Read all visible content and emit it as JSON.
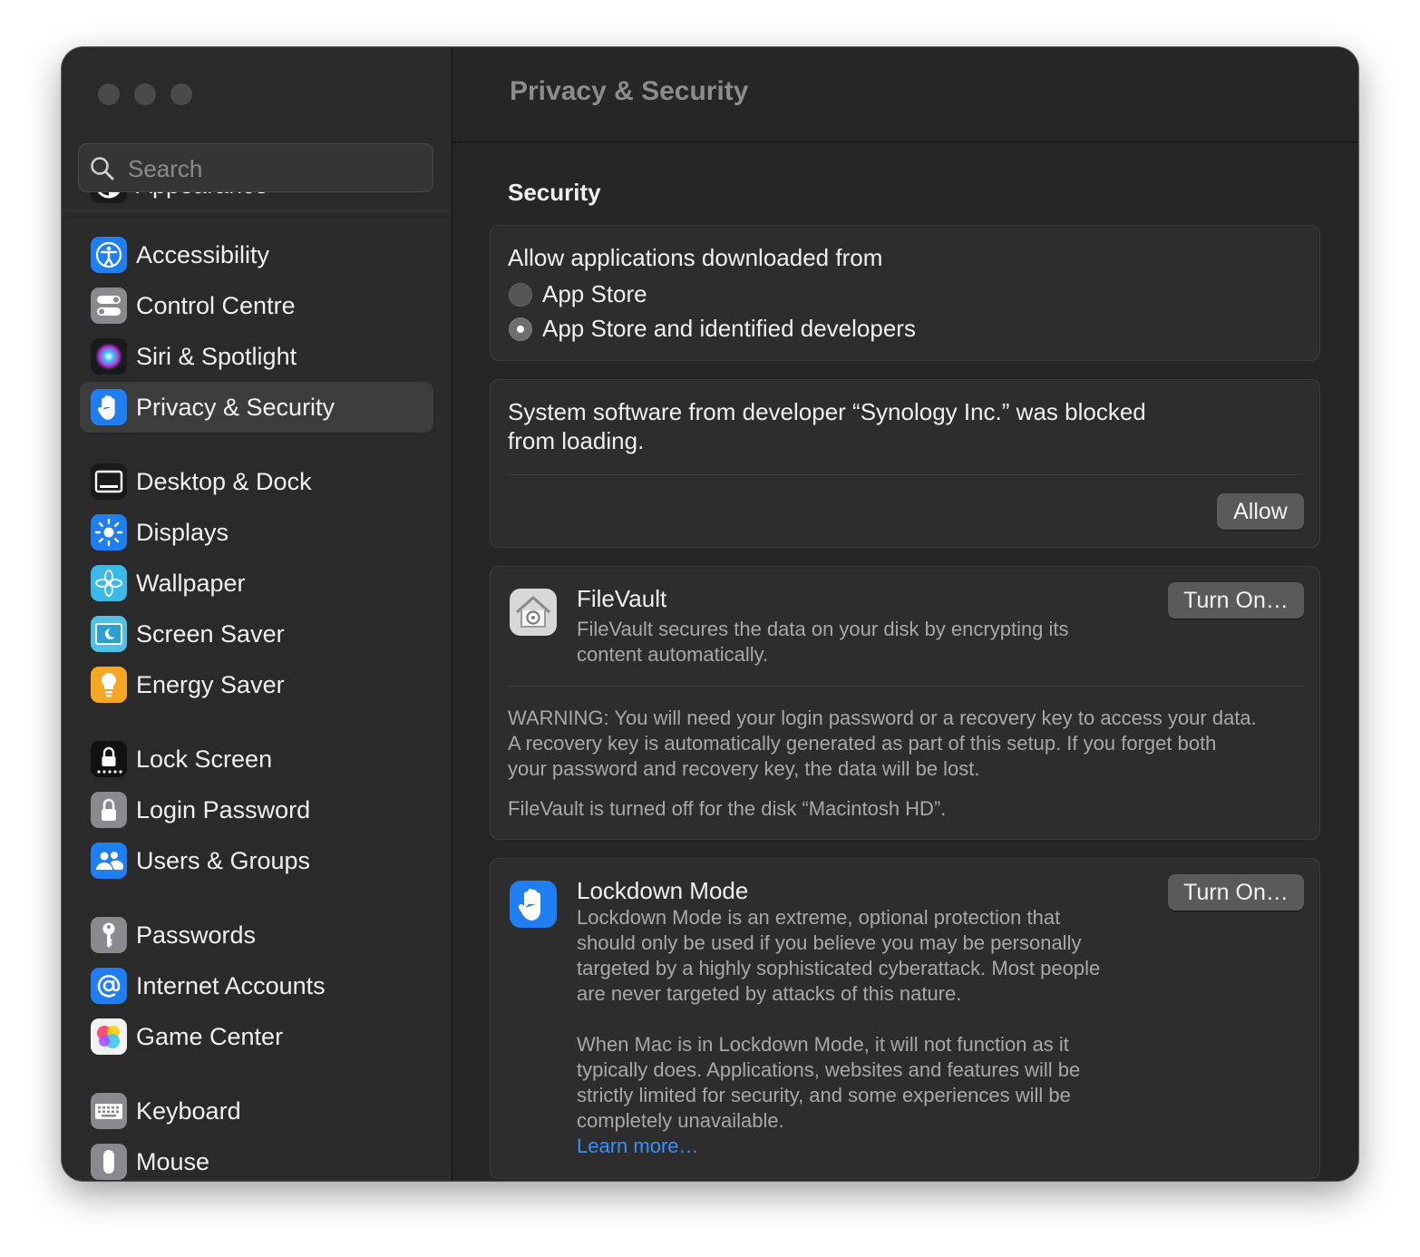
{
  "window": {
    "title": "Privacy & Security"
  },
  "sidebar": {
    "search_placeholder": "Search",
    "partial_item": "Appearance",
    "items": [
      {
        "label": "Accessibility",
        "icon": "accessibility-icon"
      },
      {
        "label": "Control Centre",
        "icon": "control-centre-icon"
      },
      {
        "label": "Siri & Spotlight",
        "icon": "siri-icon"
      },
      {
        "label": "Privacy & Security",
        "icon": "privacy-hand-icon",
        "selected": true
      },
      {
        "label": "Desktop & Dock",
        "icon": "desktop-dock-icon"
      },
      {
        "label": "Displays",
        "icon": "displays-icon"
      },
      {
        "label": "Wallpaper",
        "icon": "wallpaper-icon"
      },
      {
        "label": "Screen Saver",
        "icon": "screen-saver-icon"
      },
      {
        "label": "Energy Saver",
        "icon": "energy-saver-icon"
      },
      {
        "label": "Lock Screen",
        "icon": "lock-screen-icon"
      },
      {
        "label": "Login Password",
        "icon": "login-password-icon"
      },
      {
        "label": "Users & Groups",
        "icon": "users-groups-icon"
      },
      {
        "label": "Passwords",
        "icon": "passwords-key-icon"
      },
      {
        "label": "Internet Accounts",
        "icon": "internet-accounts-icon"
      },
      {
        "label": "Game Center",
        "icon": "game-center-icon"
      },
      {
        "label": "Keyboard",
        "icon": "keyboard-icon"
      },
      {
        "label": "Mouse",
        "icon": "mouse-icon"
      }
    ]
  },
  "main": {
    "section_title": "Security",
    "allow_apps": {
      "heading": "Allow applications downloaded from",
      "options": [
        {
          "label": "App Store",
          "selected": false
        },
        {
          "label": "App Store and identified developers",
          "selected": true
        }
      ]
    },
    "blocked": {
      "line1": "System software from developer “Synology Inc.” was blocked",
      "line2": "from loading.",
      "button": "Allow"
    },
    "filevault": {
      "title": "FileVault",
      "desc1": "FileVault secures the data on your disk by encrypting its",
      "desc2": "content automatically.",
      "button": "Turn On…",
      "warning1": "WARNING: You will need your login password or a recovery key to access your data.",
      "warning2": "A recovery key is automatically generated as part of this setup. If you forget both",
      "warning3": "your password and recovery key, the data will be lost.",
      "status": "FileVault is turned off for the disk “Macintosh HD”."
    },
    "lockdown": {
      "title": "Lockdown Mode",
      "button": "Turn On…",
      "para1": [
        "Lockdown Mode is an extreme, optional protection that",
        "should only be used if you believe you may be personally",
        "targeted by a highly sophisticated cyberattack. Most people",
        "are never targeted by attacks of this nature."
      ],
      "para2": [
        "When Mac is in Lockdown Mode, it will not function as it",
        "typically does. Applications, websites and features will be",
        "strictly limited for security, and some experiences will be",
        "completely unavailable."
      ],
      "link": "Learn more…"
    }
  },
  "colors": {
    "accent_link": "#3d8ff6",
    "window_bg": "#262626",
    "sidebar_bg": "#2a2a2a",
    "card_bg": "#2d2d2d"
  }
}
